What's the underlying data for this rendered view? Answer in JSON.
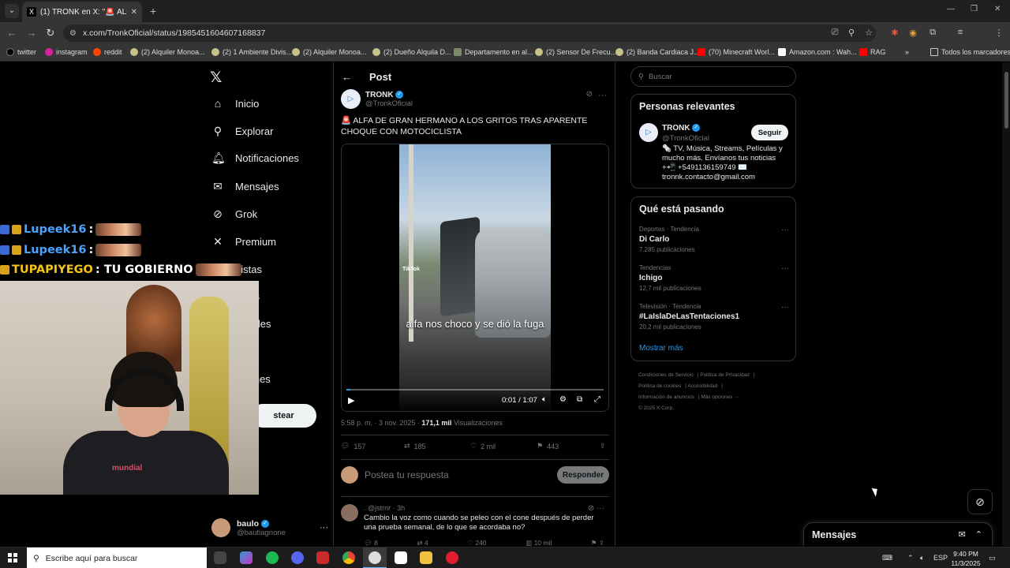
{
  "browser": {
    "tab_title": "(1) TRONK en X: \"🚨 ALFA DE G",
    "url": "x.com/TronkOficial/status/1985451604607168837",
    "bookmarks": [
      {
        "label": "twitter",
        "color": "#000000"
      },
      {
        "label": "instagram",
        "color": "#d6249f"
      },
      {
        "label": "reddit",
        "color": "#ff4500"
      },
      {
        "label": "(2) Alquiler Monoa...",
        "color": "#c9c18a"
      },
      {
        "label": "(2) 1 Ambiente Divis...",
        "color": "#c9c18a"
      },
      {
        "label": "(2) Alquiler Monoa...",
        "color": "#c9c18a"
      },
      {
        "label": "(2) Dueño Alquila D...",
        "color": "#c9c18a"
      },
      {
        "label": "Departamento en al...",
        "color": "#7a8a6a"
      },
      {
        "label": "(2) Sensor De Frecu...",
        "color": "#c9c18a"
      },
      {
        "label": "(2) Banda Cardiaca J...",
        "color": "#c9c18a"
      },
      {
        "label": "(70) Minecraft Worl...",
        "color": "#ff0000"
      },
      {
        "label": "Amazon.com : Wah...",
        "color": "#ffffff"
      },
      {
        "label": "RAG",
        "color": "#ff0000"
      }
    ],
    "all_bookmarks": "Todos los marcadores"
  },
  "nav": {
    "items": [
      {
        "label": "Inicio",
        "icon": "home-icon"
      },
      {
        "label": "Explorar",
        "icon": "search-icon"
      },
      {
        "label": "Notificaciones",
        "icon": "bell-icon"
      },
      {
        "label": "Mensajes",
        "icon": "mail-icon"
      },
      {
        "label": "Grok",
        "icon": "grok-icon"
      },
      {
        "label": "Premium",
        "icon": "x-icon"
      },
      {
        "label": "Listas",
        "icon": "list-icon"
      },
      {
        "label": "lados",
        "icon": ""
      },
      {
        "label": "nidades",
        "icon": ""
      },
      {
        "label": "pciones",
        "icon": ""
      }
    ],
    "post_button": "stear",
    "account": {
      "name": "baulo",
      "handle": "@bautiagnone"
    }
  },
  "post": {
    "header": "Post",
    "author_name": "TRONK",
    "author_handle": "@TronkOficial",
    "text_prefix": "🚨",
    "text": "ALFA DE GRAN HERMANO A LOS GRITOS TRAS APARENTE CHOQUE CON MOTOCICLISTA",
    "video": {
      "caption": "alfa nos choco y se dió la fuga",
      "watermark": "TikTok",
      "time": "0:01 / 1:07",
      "progress": 0.015
    },
    "timestamp": "5:58 p. m. · 3 nov. 2025 ·",
    "views": "171,1 mil",
    "views_label": "Visualizaciones",
    "replies": "157",
    "reposts": "185",
    "likes": "2 mil",
    "bookmarks": "443",
    "reply_placeholder": "Postea tu respuesta",
    "reply_button": "Responder"
  },
  "comment": {
    "header": ". @jstrnr · 3h",
    "text": "Cambio la voz como cuando se peleo con el cone después de perder una prueba semanal, de lo que se acordaba no?",
    "replies": "8",
    "reposts": "4",
    "likes": "240",
    "views": "10 mil"
  },
  "sidebar": {
    "search_placeholder": "Buscar",
    "relevant": {
      "title": "Personas relevantes",
      "name": "TRONK",
      "handle": "@TronkOficial",
      "follow": "Seguir",
      "bio": "🗞️ TV, Música, Streams, Películas y mucho más. Envíanos tus noticias +📲 +5491136159749 ✉️ tronnk.contacto@gmail.com"
    },
    "trending": {
      "title": "Qué está pasando",
      "items": [
        {
          "category": "Deportes · Tendencia",
          "name": "Di Carlo",
          "count": "7.285 publicaciones"
        },
        {
          "category": "Tendencias",
          "name": "Ichigo",
          "count": "12,7 mil publicaciones"
        },
        {
          "category": "Televisión · Tendencia",
          "name": "#LaIslaDeLasTentaciones1",
          "count": "20,2 mil publicaciones"
        }
      ],
      "show_more": "Mostrar más"
    },
    "footer": [
      "Condiciones de Servicio",
      "Política de Privacidad",
      "Política de cookies",
      "Accesibilidad",
      "Información de anuncios",
      "Más opciones ···",
      "© 2025 X Corp."
    ]
  },
  "messages_dock": {
    "title": "Mensajes"
  },
  "overlay": {
    "chat": [
      {
        "user": "Lupeek16",
        "message": ":"
      },
      {
        "user": "Lupeek16",
        "message": ":"
      },
      {
        "user": "TUPAPIYEGO",
        "message": ": TU GOBIERNO"
      }
    ],
    "webcam_shirt_text": "mundial"
  },
  "taskbar": {
    "search_placeholder": "Escribe aquí para buscar",
    "language": "ESP",
    "time": "9:40 PM",
    "date": "11/3/2025"
  },
  "colors": {
    "accent": "#1d9bf0",
    "background": "#000000",
    "chat_name": "#4aa3ff",
    "chat_name_alt": "#f5c518"
  }
}
